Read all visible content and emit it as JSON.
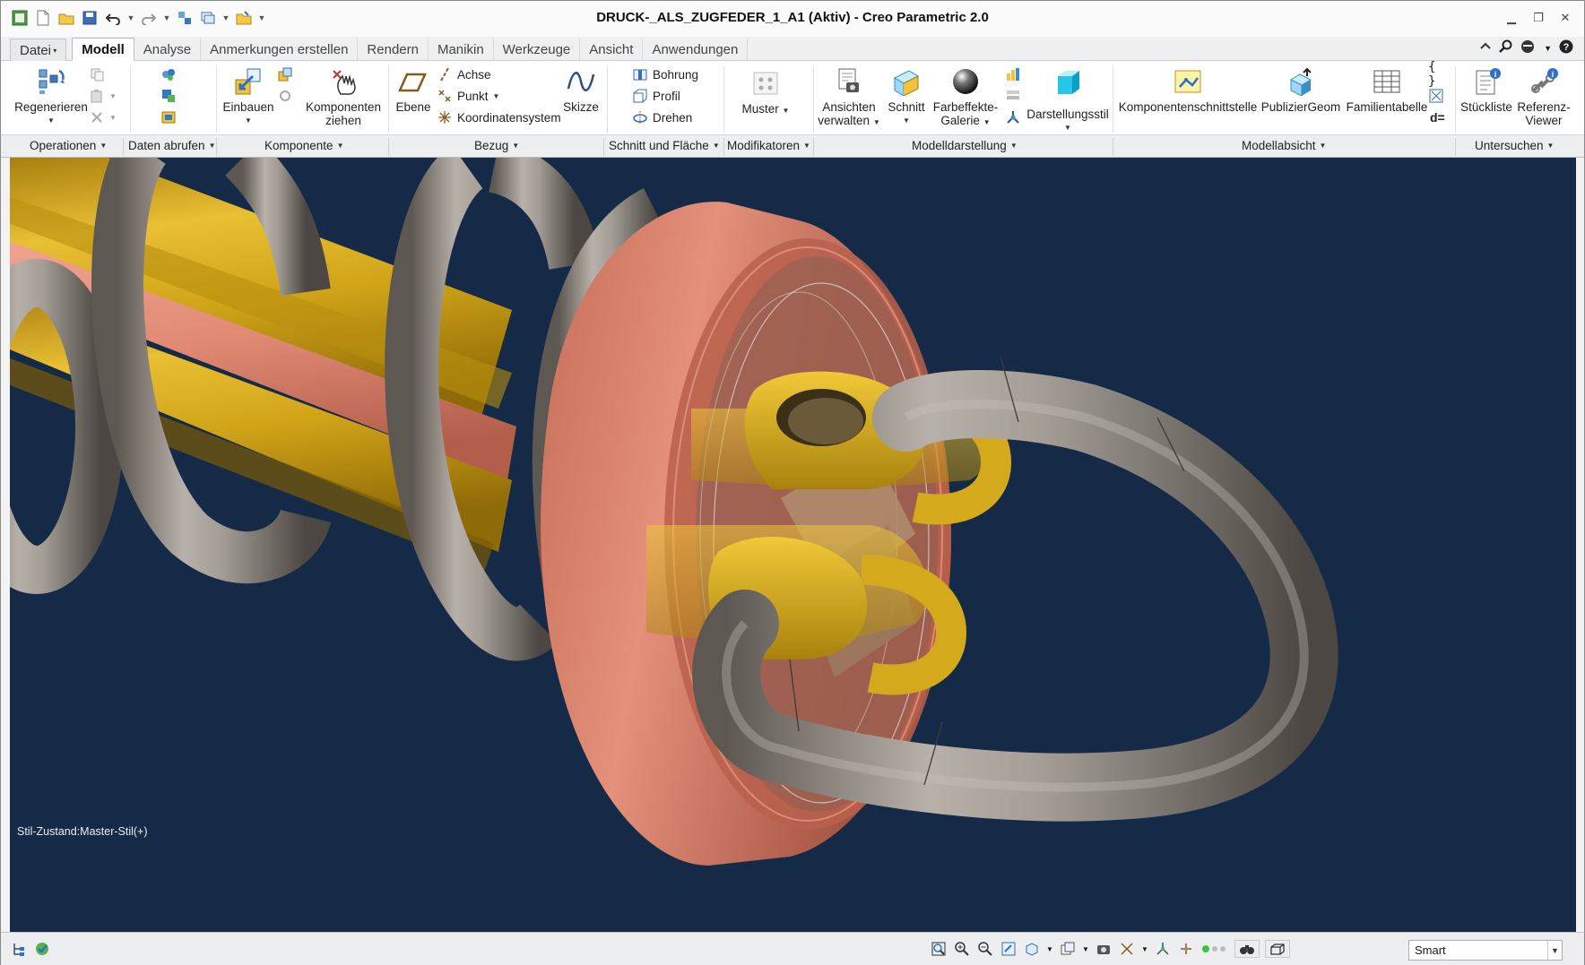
{
  "window": {
    "title": "DRUCK-_ALS_ZUGFEDER_1_A1 (Aktiv) - Creo Parametric 2.0"
  },
  "tabs": [
    {
      "label": "Datei",
      "name": "tab-datei"
    },
    {
      "label": "Modell",
      "name": "tab-modell"
    },
    {
      "label": "Analyse",
      "name": "tab-analyse"
    },
    {
      "label": "Anmerkungen erstellen",
      "name": "tab-anmerkungen-erstellen"
    },
    {
      "label": "Rendern",
      "name": "tab-rendern"
    },
    {
      "label": "Manikin",
      "name": "tab-manikin"
    },
    {
      "label": "Werkzeuge",
      "name": "tab-werkzeuge"
    },
    {
      "label": "Ansicht",
      "name": "tab-ansicht"
    },
    {
      "label": "Anwendungen",
      "name": "tab-anwendungen"
    }
  ],
  "ribbon": {
    "regenerieren": "Regenerieren",
    "einbauen": "Einbauen",
    "komponenten_ziehen_1": "Komponenten",
    "komponenten_ziehen_2": "ziehen",
    "ebene": "Ebene",
    "achse": "Achse",
    "punkt": "Punkt",
    "koordinatensystem": "Koordinatensystem",
    "skizze": "Skizze",
    "bohrung": "Bohrung",
    "profil": "Profil",
    "drehen": "Drehen",
    "muster": "Muster",
    "ansichten_verwalten_1": "Ansichten",
    "ansichten_verwalten_2": "verwalten",
    "schnitt": "Schnitt",
    "farbeffekte_1": "Farbeffekte-",
    "farbeffekte_2": "Galerie",
    "darstellungsstil": "Darstellungsstil",
    "komponentenschnittstelle": "Komponentenschnittstelle",
    "publiziergeom": "PublizierGeom",
    "familientabelle": "Familientabelle",
    "stueckliste": "Stückliste",
    "referenz_viewer_1": "Referenz-",
    "referenz_viewer_2": "Viewer",
    "relations_symbol": "d="
  },
  "groups": [
    {
      "label": "Operationen",
      "name": "group-operationen"
    },
    {
      "label": "Daten abrufen",
      "name": "group-daten-abrufen"
    },
    {
      "label": "Komponente",
      "name": "group-komponente"
    },
    {
      "label": "Bezug",
      "name": "group-bezug"
    },
    {
      "label": "Schnitt und Fläche",
      "name": "group-schnitt-und-flaeche"
    },
    {
      "label": "Modifikatoren",
      "name": "group-modifikatoren"
    },
    {
      "label": "Modelldarstellung",
      "name": "group-modelldarstellung"
    },
    {
      "label": "Modellabsicht",
      "name": "group-modellabsicht"
    },
    {
      "label": "Untersuchen",
      "name": "group-untersuchen"
    }
  ],
  "viewport": {
    "style_state": "Stil-Zustand:Master-Stil(+)"
  },
  "statusbar": {
    "filter_value": "Smart"
  },
  "colors": {
    "viewport_bg": "#152a47",
    "spring_gray": "#9a948d",
    "brass": "#d9ad1f",
    "copper": "#d07a66"
  }
}
